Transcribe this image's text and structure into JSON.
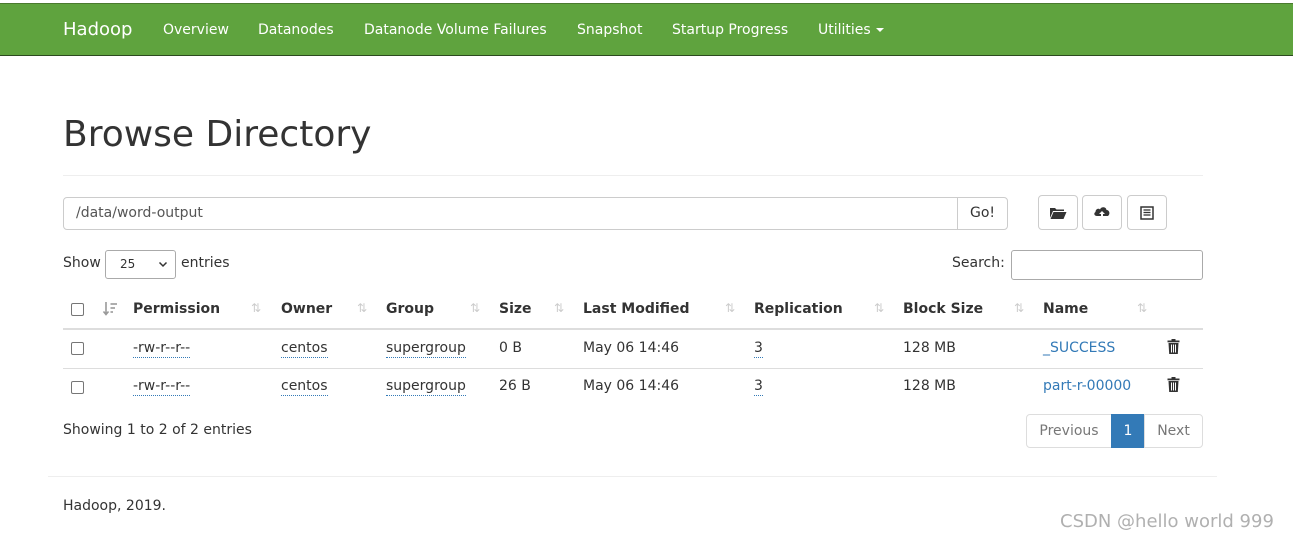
{
  "navbar": {
    "brand": "Hadoop",
    "items": [
      "Overview",
      "Datanodes",
      "Datanode Volume Failures",
      "Snapshot",
      "Startup Progress",
      "Utilities"
    ],
    "color": "#5fa33e"
  },
  "page": {
    "title": "Browse Directory"
  },
  "path_bar": {
    "value": "/data/word-output",
    "go_label": "Go!"
  },
  "toolbar_icons": [
    "create-folder-icon",
    "upload-icon",
    "cut-paste-icon"
  ],
  "table_controls": {
    "show_label": "Show",
    "page_length": "25",
    "entries_label": "entries",
    "search_label": "Search:",
    "search_value": ""
  },
  "table": {
    "headers": [
      "Permission",
      "Owner",
      "Group",
      "Size",
      "Last Modified",
      "Replication",
      "Block Size",
      "Name"
    ],
    "rows": [
      {
        "permission": "-rw-r--r--",
        "owner": "centos",
        "group": "supergroup",
        "size": "0 B",
        "last_modified": "May 06 14:46",
        "replication": "3",
        "block_size": "128 MB",
        "name": "_SUCCESS"
      },
      {
        "permission": "-rw-r--r--",
        "owner": "centos",
        "group": "supergroup",
        "size": "26 B",
        "last_modified": "May 06 14:46",
        "replication": "3",
        "block_size": "128 MB",
        "name": "part-r-00000"
      }
    ]
  },
  "pagination": {
    "info": "Showing 1 to 2 of 2 entries",
    "previous": "Previous",
    "current": "1",
    "next": "Next"
  },
  "footer": {
    "text": "Hadoop, 2019."
  },
  "watermark": "CSDN @hello world 999",
  "colors": {
    "link": "#337ab7",
    "active_page": "#337ab7"
  }
}
